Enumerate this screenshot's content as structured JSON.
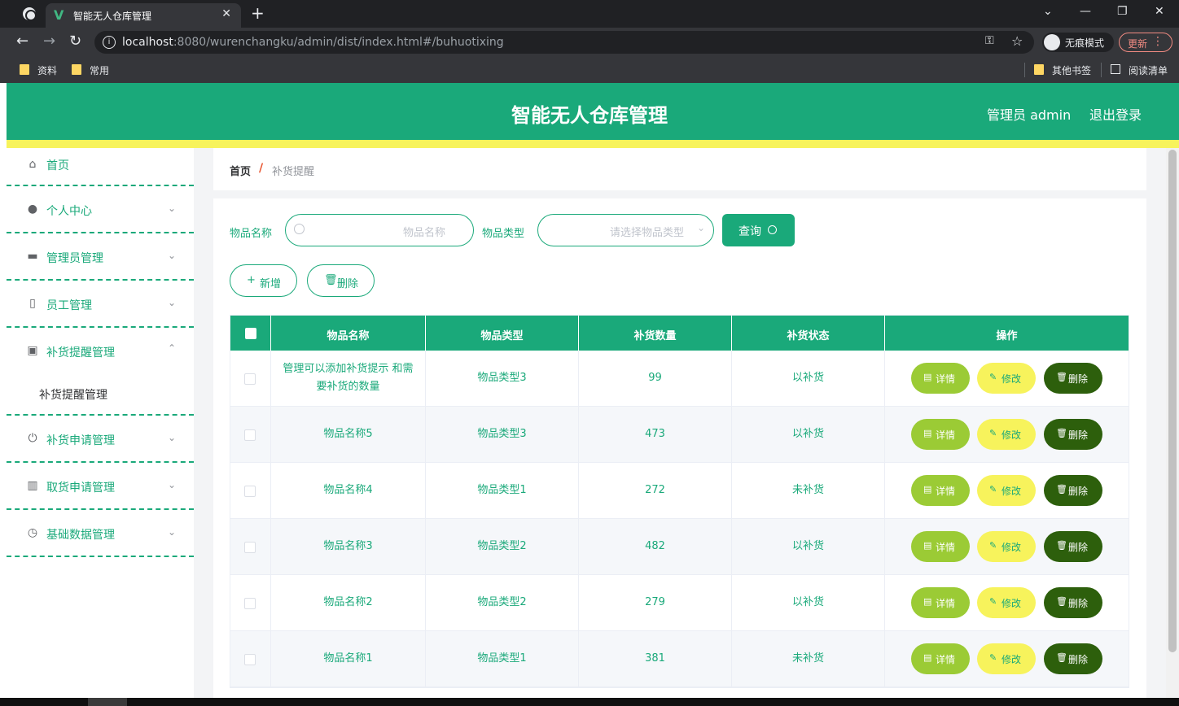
{
  "browser": {
    "tab_title": "智能无人仓库管理",
    "tab_favicon": "V",
    "tab_close": "✕",
    "new_tab": "+",
    "window_controls": [
      "⌄",
      "—",
      "❐",
      "✕"
    ],
    "url_host": "localhost",
    "url_rest": ":8080/wurenchangku/admin/dist/index.html#/buhuotixing",
    "incognito_label": "无痕模式",
    "update_label": "更新",
    "bookmarks": [
      "资料",
      "常用"
    ],
    "other_bookmarks": "其他书签",
    "reading_list": "阅读清单"
  },
  "header": {
    "title": "智能无人仓库管理",
    "admin_label": "管理员 admin",
    "logout_label": "退出登录"
  },
  "sidebar": {
    "items": [
      {
        "label": "首页",
        "icon": "home-icon"
      },
      {
        "label": "个人中心",
        "icon": "user-icon"
      },
      {
        "label": "管理员管理",
        "icon": "ticket-icon"
      },
      {
        "label": "员工管理",
        "icon": "mic-icon"
      },
      {
        "label": "补货提醒管理",
        "icon": "clipboard-icon"
      },
      {
        "label": "补货申请管理",
        "icon": "power-icon"
      },
      {
        "label": "取货申请管理",
        "icon": "chart-icon"
      },
      {
        "label": "基础数据管理",
        "icon": "clock-icon"
      }
    ],
    "submenu_item": "补货提醒管理"
  },
  "breadcrumb": {
    "home": "首页",
    "separator": "/",
    "current": "补货提醒"
  },
  "filters": {
    "name_label": "物品名称",
    "name_placeholder": "物品名称",
    "type_label": "物品类型",
    "type_placeholder": "请选择物品类型",
    "query_label": "查询"
  },
  "actions": {
    "add_label": "新增",
    "delete_label": "删除"
  },
  "table": {
    "columns": [
      "物品名称",
      "物品类型",
      "补货数量",
      "补货状态",
      "操作"
    ],
    "row_buttons": {
      "detail": "详情",
      "edit": "修改",
      "delete": "删除"
    },
    "rows": [
      {
        "name": "管理可以添加补货提示 和需要补货的数量",
        "type": "物品类型3",
        "qty": "99",
        "status": "以补货"
      },
      {
        "name": "物品名称5",
        "type": "物品类型3",
        "qty": "473",
        "status": "以补货"
      },
      {
        "name": "物品名称4",
        "type": "物品类型1",
        "qty": "272",
        "status": "未补货"
      },
      {
        "name": "物品名称3",
        "type": "物品类型2",
        "qty": "482",
        "status": "以补货"
      },
      {
        "name": "物品名称2",
        "type": "物品类型2",
        "qty": "279",
        "status": "以补货"
      },
      {
        "name": "物品名称1",
        "type": "物品类型1",
        "qty": "381",
        "status": "未补货"
      }
    ]
  },
  "colors": {
    "primary": "#1aa97a",
    "accent_yellow": "#f7f35c",
    "detail_green": "#9bcb35",
    "delete_dark_green": "#2d5f0c"
  }
}
